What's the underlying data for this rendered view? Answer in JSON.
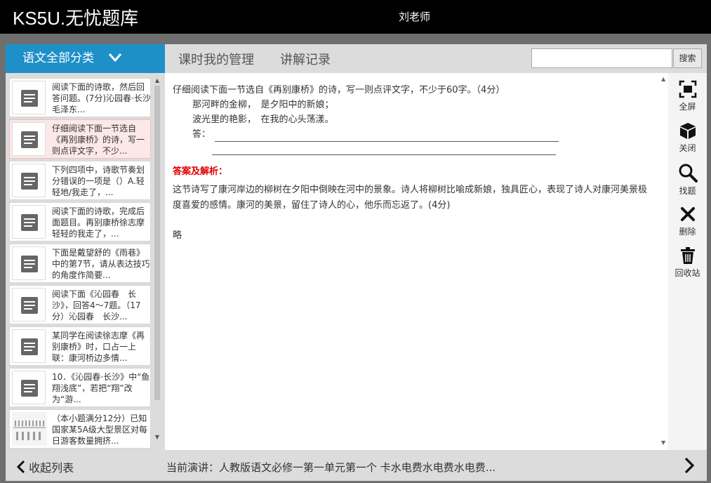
{
  "header": {
    "logo": "KS5U.无忧题库",
    "user": "刘老师"
  },
  "category_button": {
    "label": "语文全部分类"
  },
  "tabs": [
    {
      "label": "课时我的管理"
    },
    {
      "label": "讲解记录"
    }
  ],
  "search": {
    "placeholder": "",
    "button_label": "搜索"
  },
  "list": [
    {
      "text": "阅读下面的诗歌，然后回答问题。(7分)沁园春·长沙毛泽东...",
      "selected": false,
      "icon": "document-icon"
    },
    {
      "text": "仔细阅读下面一节选自《再别康桥》的诗，写一则点评文字，不少...",
      "selected": true,
      "icon": "document-icon"
    },
    {
      "text": "下列四项中，诗歌节奏划分错误的一项是（）A.轻轻地/我走了，...",
      "selected": false,
      "icon": "document-icon"
    },
    {
      "text": "阅读下面的诗歌，完成后面题目。再别康桥徐志摩轻轻的我走了，...",
      "selected": false,
      "icon": "document-icon"
    },
    {
      "text": "下面是戴望舒的《雨巷》中的第7节，请从表达技巧的角度作简要...",
      "selected": false,
      "icon": "document-icon"
    },
    {
      "text": "阅读下面《沁园春　长沙》，回答4～7题。（17分）沁园春　长沙...",
      "selected": false,
      "icon": "document-icon"
    },
    {
      "text": "某同学在阅读徐志摩《再别康桥》时，口占一上联：康河桥边多情...",
      "selected": false,
      "icon": "document-icon"
    },
    {
      "text": "10．《沁园春·长沙》中“鱼翔浅底”，若把“翔”改为“游...",
      "selected": false,
      "icon": "document-icon"
    },
    {
      "text": "（本小题满分12分）已知国家某5A级大型景区对每日游客数量拥挤...",
      "selected": false,
      "icon": "image-thumbnail"
    }
  ],
  "question": {
    "stem": "仔细阅读下面一节选自《再别康桥》的诗，写一则点评文字，不少于60字。（4分）",
    "line1": "那河畔的金柳，　是夕阳中的新娘；",
    "line2": "波光里的艳影，　在我的心头荡漾。",
    "answer_prefix": "答："
  },
  "answer": {
    "label": "答案及解析：",
    "text": "这节诗写了康河岸边的柳树在夕阳中倒映在河中的景象。诗人将柳树比喻成新娘，独具匠心，表现了诗人对康河美景极度喜爱的感情。康河的美景，留住了诗人的心，他乐而忘返了。(4分)",
    "brief": "略"
  },
  "tools": [
    {
      "label": "全屏",
      "icon": "fullscreen-icon"
    },
    {
      "label": "关闭",
      "icon": "cube-icon"
    },
    {
      "label": "找题",
      "icon": "search-icon"
    },
    {
      "label": "删除",
      "icon": "close-icon"
    },
    {
      "label": "回收站",
      "icon": "trash-icon"
    }
  ],
  "footer": {
    "collapse_label": "收起列表",
    "current": "当前演讲：人教版语文必修一第一单元第一个 卡水电费水电费水电费..."
  },
  "colors": {
    "accent": "#1e90c8",
    "answer_label": "#e00000",
    "selected_bg": "#fde8e8"
  }
}
